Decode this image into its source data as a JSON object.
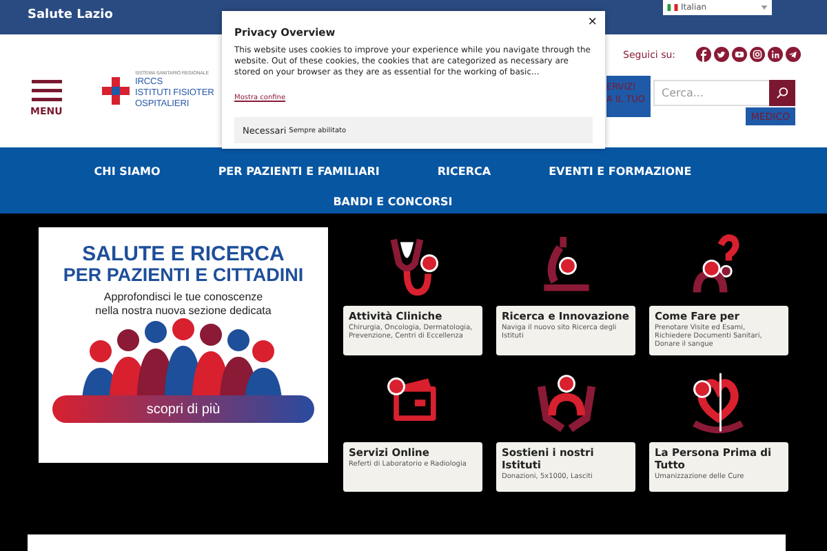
{
  "top_bar": {
    "site_name": "Salute Lazio",
    "language": "Italian"
  },
  "header": {
    "menu_label": "MENU",
    "logo": {
      "overline": "SISTEMA SANITARIO REGIONALE",
      "lines": [
        "IRCCS",
        "ISTITUTI FISIOTER",
        "OSPITALIERI"
      ]
    },
    "follow_label": "Seguici su:",
    "services_lines": [
      "ERVIZI",
      "A IL TUO"
    ],
    "search": {
      "placeholder": "Cerca..."
    },
    "medico_label": "MEDICO"
  },
  "nav": {
    "rows": [
      [
        "CHI SIAMO",
        "PER PAZIENTI E FAMILIARI",
        "RICERCA",
        "EVENTI E FORMAZIONE"
      ],
      [
        "BANDI E CONCORSI"
      ]
    ]
  },
  "banner": {
    "title_lines": [
      "SALUTE E RICERCA",
      "PER PAZIENTI E CITTADINI"
    ],
    "subtitle_lines": [
      "Approfondisci le tue conoscenze",
      "nella nostra nuova sezione dedicata"
    ],
    "button": "scopri di più"
  },
  "services": [
    {
      "kind": "stethoscope",
      "title": "Attività Cliniche",
      "description": "Chirurgia, Oncologia, Dermatologia, Prevenzione, Centri di Eccellenza"
    },
    {
      "kind": "microscope",
      "title": "Ricerca e Innovazione",
      "description": "Naviga il nuovo sito Ricerca degli Istituti"
    },
    {
      "kind": "question",
      "title": "Come Fare per",
      "description": "Prenotare Visite ed Esami, Richiedere Documenti Sanitari, Donare il sangue"
    },
    {
      "kind": "wallet",
      "title": "Servizi Online",
      "description": "Referti di Laboratorio e Radiologia"
    },
    {
      "kind": "hands",
      "title": "Sostieni i nostri Istituti",
      "description": "Donazioni, 5x1000, Lasciti"
    },
    {
      "kind": "heart",
      "title": "La Persona Prima di Tutto",
      "description": "Umanizzazione delle Cure"
    }
  ],
  "privacy": {
    "title": "Privacy Overview",
    "text": "This website uses cookies to improve your experience while you navigate through the website. Out of these cookies, the cookies that are categorized as necessary are stored on your browser as they are as essential for the working of basic...",
    "link": "Mostra confine",
    "necessary_label": "Necessari",
    "always_label": "Sempre abilitato",
    "close": "×"
  }
}
